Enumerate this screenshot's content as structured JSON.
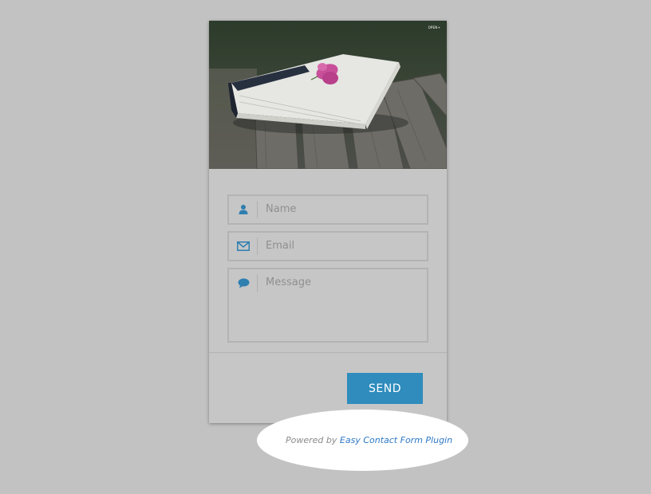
{
  "form": {
    "hero_image_alt": "book with flower on bench",
    "hero_badge": "OPEN+",
    "name_placeholder": "Name",
    "email_placeholder": "Email",
    "message_placeholder": "Message",
    "send_label": "SEND",
    "icons": {
      "name": "user-icon",
      "email": "envelope-icon",
      "message": "speech-bubble-icon"
    }
  },
  "footer": {
    "powered_prefix": "Powered by",
    "plugin_link_text": "Easy Contact Form Plugin"
  },
  "colors": {
    "background": "#c2c2c2",
    "accent": "#2f8cbd",
    "link": "#2d78c6",
    "icon": "#2f7fb0"
  }
}
